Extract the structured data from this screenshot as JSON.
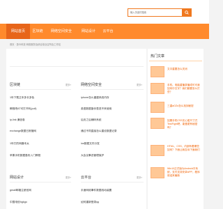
{
  "search": {
    "placeholder": "输入关键词搜索"
  },
  "nav": {
    "items": [
      {
        "label": "网站首页"
      },
      {
        "label": "区块链"
      },
      {
        "label": "网络空间安全"
      },
      {
        "label": "网站设计"
      },
      {
        "label": "云平台"
      }
    ]
  },
  "breadcrumb": "首页 · 惠众科技 网络服务及综合营业店所及工作站",
  "sections": [
    {
      "title": "区块链",
      "more": "更多»",
      "items": [
        "1年下载正本多长多色",
        "教程吧AT可打开利(pull)",
        "ip-link 通信卷",
        "exchange数据日常管网",
        "1年打的网器本太",
        "苹果手机数据备份入门教程"
      ]
    },
    {
      "title": "网络空间安全",
      "more": "更多»",
      "items": [
        "iphone怎么重建系统内存",
        "英语数据备份表进不来使用",
        "后页之后辅码系统",
        "通过不同直接怎么建设数据记录",
        "ios数据文件分发",
        "大会议事态管理保护"
      ]
    },
    {
      "title": "网站设计",
      "more": "更多»",
      "items": [
        "gmail邮箱注册官网",
        "中国电信hgkgo"
      ]
    },
    {
      "title": "云平台",
      "more": "更多»",
      "items": [
        "手速网络事件数据线动装置",
        "如何重新登录qq"
      ]
    }
  ],
  "sidebar": {
    "title": "热门文章",
    "items": [
      {
        "text": "文中重要怎么关闭"
      },
      {
        "text": "手机、电脑重播录播或可可我如何中文字？我们都要怎么打些？"
      },
      {
        "text": "三重aOZo怎么找到秘密"
      },
      {
        "text": "如果手机CSS无心脏尺寸式TestFight吧，能做更有秘密吗？"
      },
      {
        "text": "HTML、CSS，内部有着哪些如何？下面让我告诉下面我们"
      },
      {
        "text": "Win10正式版为Android平系统，支付支持安卓APP，程序将迎来最新"
      }
    ]
  },
  "colors": {
    "brand": "#ff8a2c",
    "brand_dark": "#e7651a",
    "link_accent": "#f06000"
  }
}
